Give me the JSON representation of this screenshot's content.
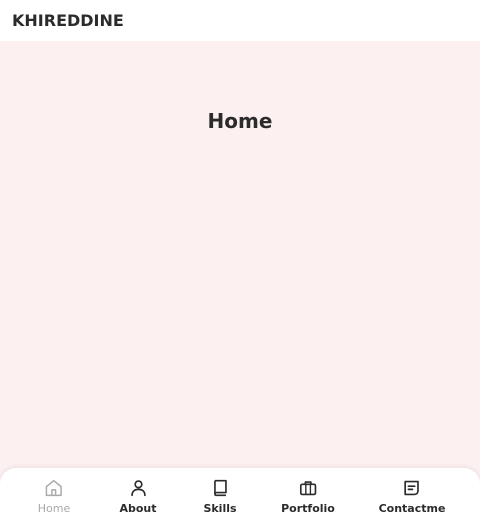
{
  "header": {
    "logo": "KHIREDDINE"
  },
  "main": {
    "section_title": "Home"
  },
  "nav": {
    "items": [
      {
        "label": "Home",
        "icon": "home-icon",
        "active": true
      },
      {
        "label": "About",
        "icon": "user-icon",
        "active": false
      },
      {
        "label": "Skills",
        "icon": "book-icon",
        "active": false
      },
      {
        "label": "Portfolio",
        "icon": "briefcase-icon",
        "active": false
      },
      {
        "label": "Contactme",
        "icon": "message-icon",
        "active": false
      }
    ]
  },
  "colors": {
    "background": "#fdf0f0",
    "text": "#2b2b2b",
    "inactive": "#a9a9a9",
    "surface": "#ffffff"
  }
}
